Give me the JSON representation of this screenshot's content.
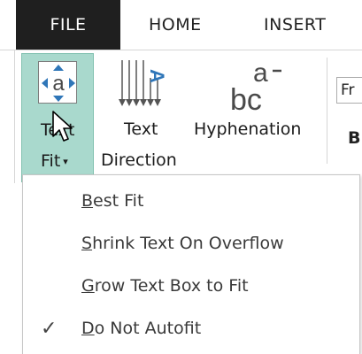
{
  "tabs": {
    "file": "FILE",
    "home": "HOME",
    "insert": "INSERT"
  },
  "ribbon": {
    "text_fit": {
      "line1": "Text",
      "line2": "Fit",
      "caret": "▾"
    },
    "text_direction": {
      "line1": "Text",
      "line2": "Direction"
    },
    "hyphenation": {
      "line1": "Hyphenation"
    },
    "font_box_value": "Fr",
    "bold_letter": "B"
  },
  "menu": {
    "items": [
      {
        "prefix": "B",
        "rest": "est Fit",
        "checked": false
      },
      {
        "prefix": "S",
        "rest": "hrink Text On Overflow",
        "checked": false
      },
      {
        "prefix": "G",
        "rest": "row Text Box to Fit",
        "checked": false
      },
      {
        "prefix": "D",
        "rest": "o Not Autofit",
        "checked": true
      }
    ],
    "check_glyph": "✓"
  },
  "icons": {
    "text_fit": "text-fit-icon",
    "text_direction": "text-direction-icon",
    "hyphenation": "hyphenation-icon",
    "cursor": "mouse-pointer-icon"
  }
}
